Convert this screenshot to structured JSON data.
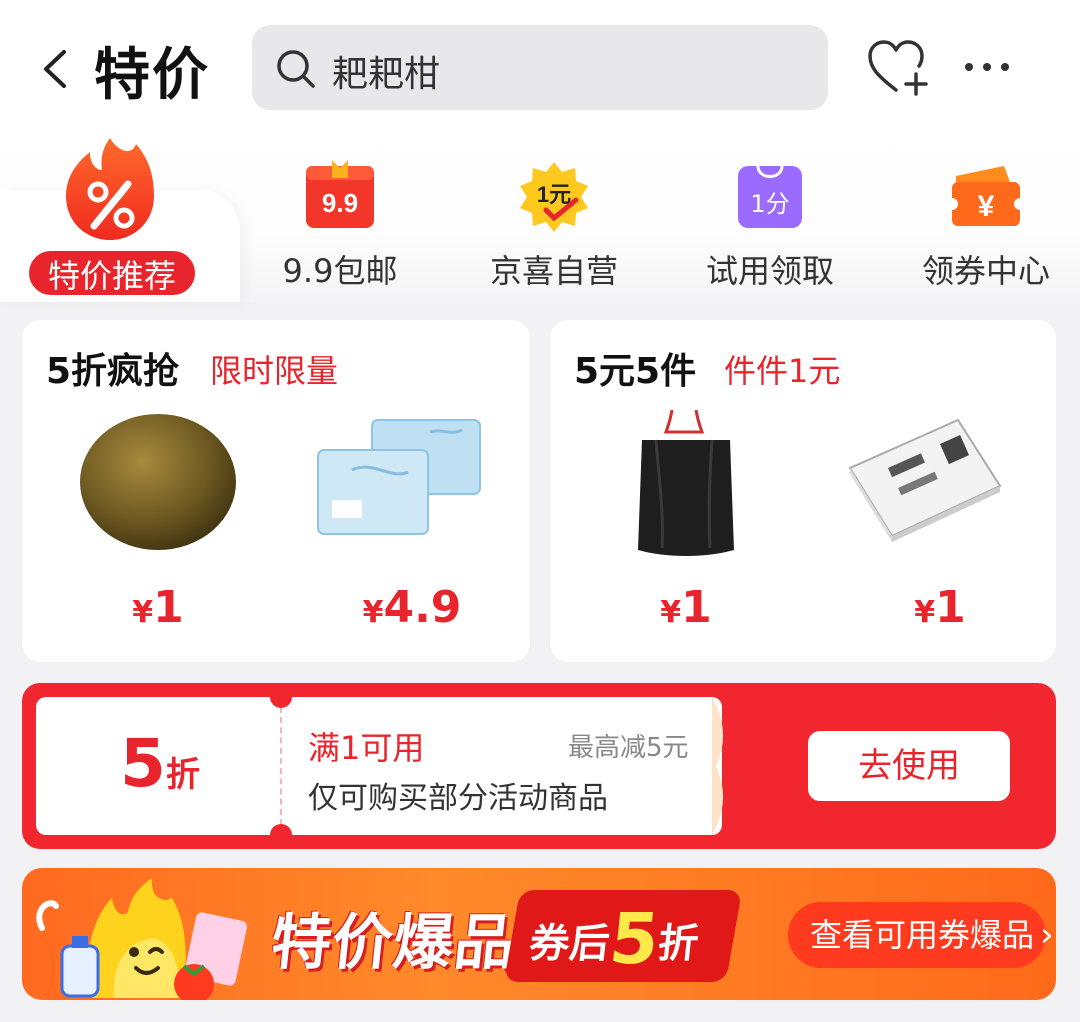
{
  "header": {
    "title": "特价",
    "search_text": "耙耙柑"
  },
  "categories": {
    "hero_label": "特价推荐",
    "hero_icon": "percent-flame-icon",
    "items": [
      {
        "label": "9.9包邮",
        "icon_text": "9.9",
        "icon": "gift-box-icon"
      },
      {
        "label": "京喜自营",
        "icon_text": "1元",
        "icon": "star-badge-icon"
      },
      {
        "label": "试用领取",
        "icon_text": "1分",
        "icon": "shopping-bag-icon"
      },
      {
        "label": "领券中心",
        "icon_text": "¥",
        "icon": "ticket-icon"
      }
    ]
  },
  "cards": [
    {
      "title": "5折疯抢",
      "subtitle": "限时限量",
      "products": [
        {
          "image": "monk-fruit",
          "currency": "¥",
          "price": "1"
        },
        {
          "image": "tissue-packs",
          "currency": "¥",
          "price": "4.9"
        }
      ]
    },
    {
      "title": "5元5件",
      "subtitle": "件件1元",
      "products": [
        {
          "image": "garbage-bags",
          "currency": "¥",
          "price": "1"
        },
        {
          "image": "shipping-labels",
          "currency": "¥",
          "price": "1"
        }
      ]
    }
  ],
  "coupon": {
    "discount_value": "5",
    "discount_unit": "折",
    "condition": "满1可用",
    "max_discount": "最高减5元",
    "description": "仅可购买部分活动商品",
    "button_label": "去使用"
  },
  "banner": {
    "title": "特价爆品",
    "tag_prefix": "券后",
    "tag_number": "5",
    "tag_suffix": "折",
    "button_label": "查看可用券爆品",
    "button_chevron": "›"
  },
  "colors": {
    "accent_red": "#e8242c",
    "coupon_red": "#f2262e",
    "banner_orange": "#ff7a22",
    "search_bg": "#e8e8ea"
  }
}
